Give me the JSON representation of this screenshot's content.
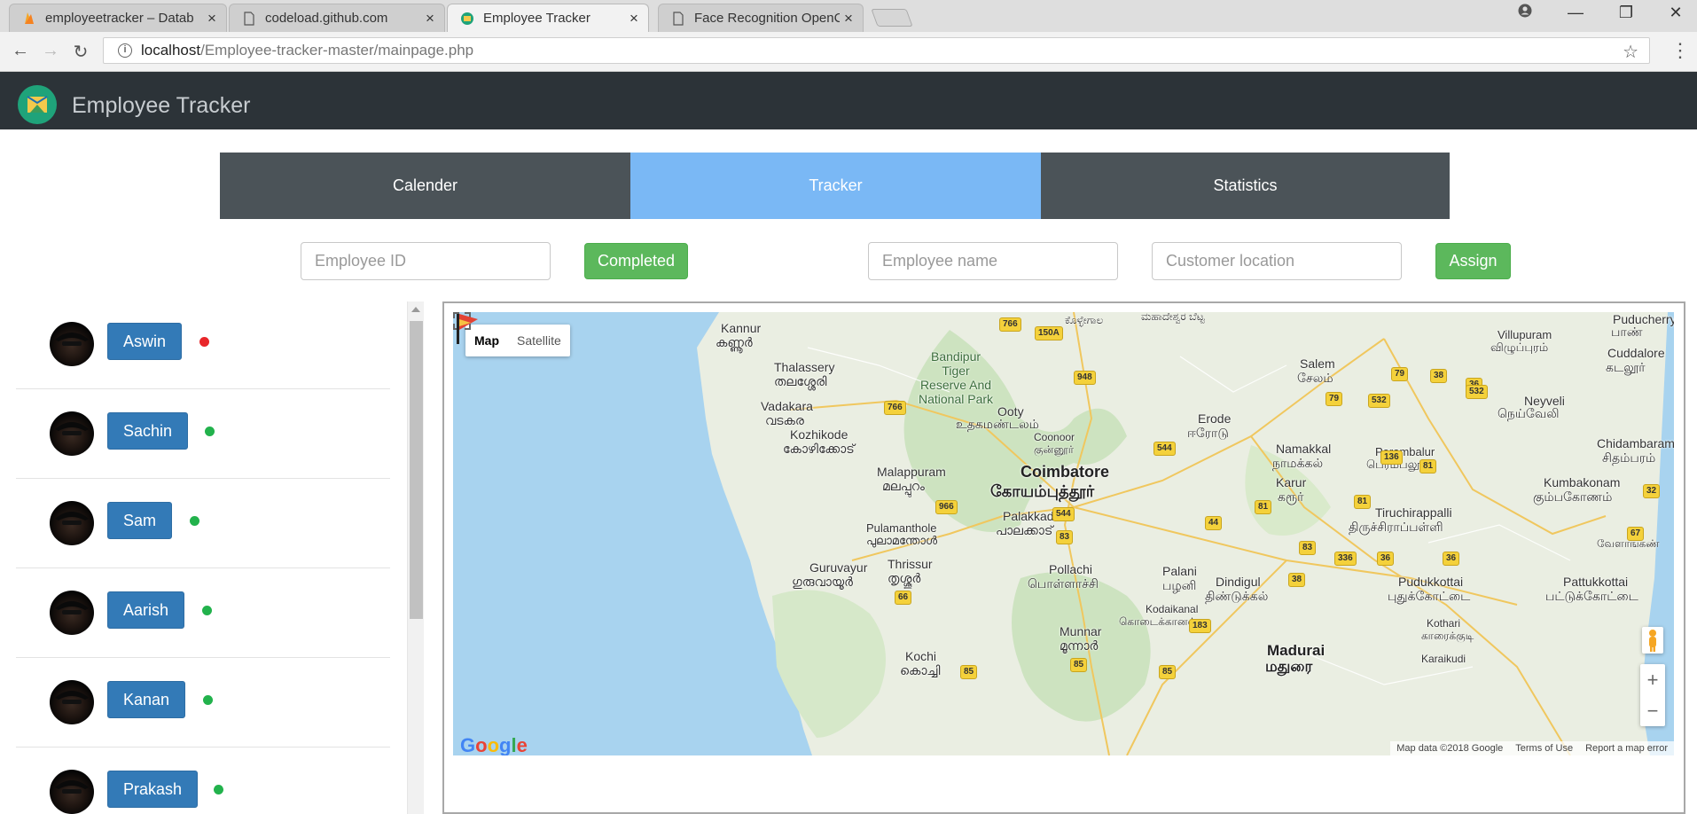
{
  "browser": {
    "tabs": [
      {
        "title": "employeetracker – Datab",
        "icon": "firebase-icon"
      },
      {
        "title": "codeload.github.com",
        "icon": "page-icon"
      },
      {
        "title": "Employee Tracker",
        "icon": "app-globe-icon"
      },
      {
        "title": "Face Recognition OpenCV",
        "icon": "page-icon"
      }
    ],
    "url_host": "localhost",
    "url_path": "/Employee-tracker-master/mainpage.php"
  },
  "app": {
    "title": "Employee Tracker"
  },
  "nav": {
    "calendar": "Calender",
    "tracker": "Tracker",
    "statistics": "Statistics",
    "active_color": "#7ab8f5"
  },
  "form": {
    "employee_id_placeholder": "Employee ID",
    "completed_label": "Completed",
    "employee_name_placeholder": "Employee name",
    "customer_location_placeholder": "Customer location",
    "assign_label": "Assign"
  },
  "employees": [
    {
      "name": "Aswin",
      "status": "offline",
      "status_color": "#e8262a"
    },
    {
      "name": "Sachin",
      "status": "online",
      "status_color": "#22b24c"
    },
    {
      "name": "Sam",
      "status": "online",
      "status_color": "#22b24c"
    },
    {
      "name": "Aarish",
      "status": "online",
      "status_color": "#22b24c"
    },
    {
      "name": "Kanan",
      "status": "online",
      "status_color": "#22b24c"
    },
    {
      "name": "Prakash",
      "status": "online",
      "status_color": "#22b24c"
    }
  ],
  "map": {
    "type_map": "Map",
    "type_satellite": "Satellite",
    "labels": {
      "kannur": "Kannur",
      "kannur_ta": "കണ്ണൂർ",
      "thalassery": "Thalassery",
      "thalassery_ta": "തലശ്ശേരി",
      "vadakara": "Vadakara",
      "vadakara_ta": "വടകര",
      "kozhikode": "Kozhikode",
      "kozhikode_ta": "കോഴിക്കോട്",
      "malappuram": "Malappuram",
      "malappuram_ta": "മലപ്പുറം",
      "bandipur": "Bandipur\nTiger\nReserve And\nNational Park",
      "ooty": "Ooty",
      "ooty_ta": "உதகமண்டலம்",
      "coonoor": "Coonoor",
      "coonoor_ta": "குன்னூர்",
      "coimbatore": "Coimbatore",
      "coimbatore_ta": "கோயம்புத்தூர்",
      "palakkad": "Palakkad",
      "palakkad_ta": "പാലക്കാട്",
      "pulamanthole": "Pulamanthole",
      "pulamanthole_ta": "പുലാമന്തോൾ",
      "thrissur": "Thrissur",
      "thrissur_ta": "തൃശ്ശൂർ",
      "guruvayur": "Guruvayur",
      "guruvayur_ta": "ഗുരുവായൂർ",
      "pollachi": "Pollachi",
      "pollachi_ta": "பொள்ளாச்சி",
      "palani": "Palani",
      "palani_ta": "பழனி",
      "munnar": "Munnar",
      "munnar_ta": "മൂന്നാർ",
      "kochi": "Kochi",
      "kochi_ta": "കൊച്ചി",
      "kodaikanal": "Kodaikanal",
      "kodaikanal_ta": "கொடைக்கானல்",
      "dindigul": "Dindigul",
      "dindigul_ta": "திண்டுக்கல்",
      "madurai": "Madurai",
      "madurai_ta": "மதுரை",
      "erode": "Erode",
      "erode_ta": "ஈரோடு",
      "salem": "Salem",
      "salem_ta": "சேலம்",
      "namakkal": "Namakkal",
      "namakkal_ta": "நாமக்கல்",
      "karur": "Karur",
      "karur_ta": "கரூர்",
      "perambalur": "Perambalur",
      "perambalur_ta": "பெரம்பலூர்",
      "tiruchirappalli": "Tiruchirappalli",
      "tiruchirappalli_ta": "திருச்சிராப்பள்ளி",
      "villupuram": "Villupuram",
      "villupuram_ta": "விழுப்புரம்",
      "cuddalore": "Cuddalore",
      "cuddalore_ta": "கடலூர்",
      "neyveli": "Neyveli",
      "neyveli_ta": "நெய்வேலி",
      "chidambaram": "Chidambaram",
      "chidambaram_ta": "சிதம்பரம்",
      "kumbakonam": "Kumbakonam",
      "kumbakonam_ta": "கும்பகோணம்",
      "pudukkottai": "Pudukkottai",
      "pudukkottai_ta": "புதுக்கோட்டை",
      "pattukkottai": "Pattukkottai",
      "pattukkottai_ta": "பட்டுக்கோட்டை",
      "kothari": "Kothari",
      "kothari_ta": "காரைக்குடி",
      "karaikudi": "Karaikudi",
      "puducherry": "Puducherry",
      "puducherry_ta": "பாண்",
      "vedaranyam": "வேளாங்கண்",
      "top_kannada": "ಮಹಾದೇಶ್ವರ ಬೆಟ್ಟ",
      "kollegal": "ಕೊಳ್ಳೇಗಾಲ"
    },
    "shields": [
      "766",
      "150A",
      "948",
      "766",
      "544",
      "966",
      "544",
      "83",
      "66",
      "85",
      "85",
      "85",
      "183",
      "44",
      "81",
      "83",
      "336",
      "36",
      "79",
      "38",
      "36",
      "532",
      "79",
      "532",
      "136",
      "81",
      "32",
      "67",
      "38",
      "81",
      "36"
    ],
    "footer_data": "Map data ©2018 Google",
    "footer_terms": "Terms of Use",
    "footer_report": "Report a map error",
    "google": "Google",
    "zoom_in": "+",
    "zoom_out": "−"
  }
}
